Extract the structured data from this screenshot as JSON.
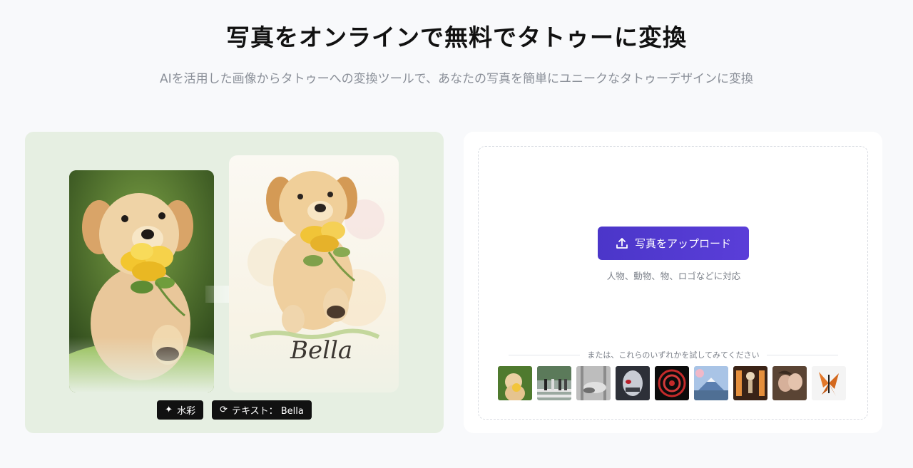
{
  "header": {
    "title": "写真をオンラインで無料でタトゥーに変換",
    "subtitle": "AIを活用した画像からタトゥーへの変換ツールで、あなたの写真を簡単にユニークなタトゥーデザインに変換"
  },
  "preview": {
    "tattoo_name": "Bella",
    "tags": [
      {
        "icon": "sparkle-icon",
        "label": "水彩"
      },
      {
        "icon": "text-cycle-icon",
        "label": "テキスト： Bella"
      }
    ]
  },
  "upload": {
    "button_label": "写真をアップロード",
    "hint": "人物、動物、物、ロゴなどに対応",
    "try_text": "または、これらのいずれかを試してみてください",
    "samples": [
      "puppy",
      "crosswalk",
      "statue",
      "mask",
      "mandala",
      "mountain",
      "skeleton",
      "couple",
      "butterfly"
    ]
  },
  "colors": {
    "accent": "#4b36c9",
    "preview_bg": "#e6efe2"
  }
}
